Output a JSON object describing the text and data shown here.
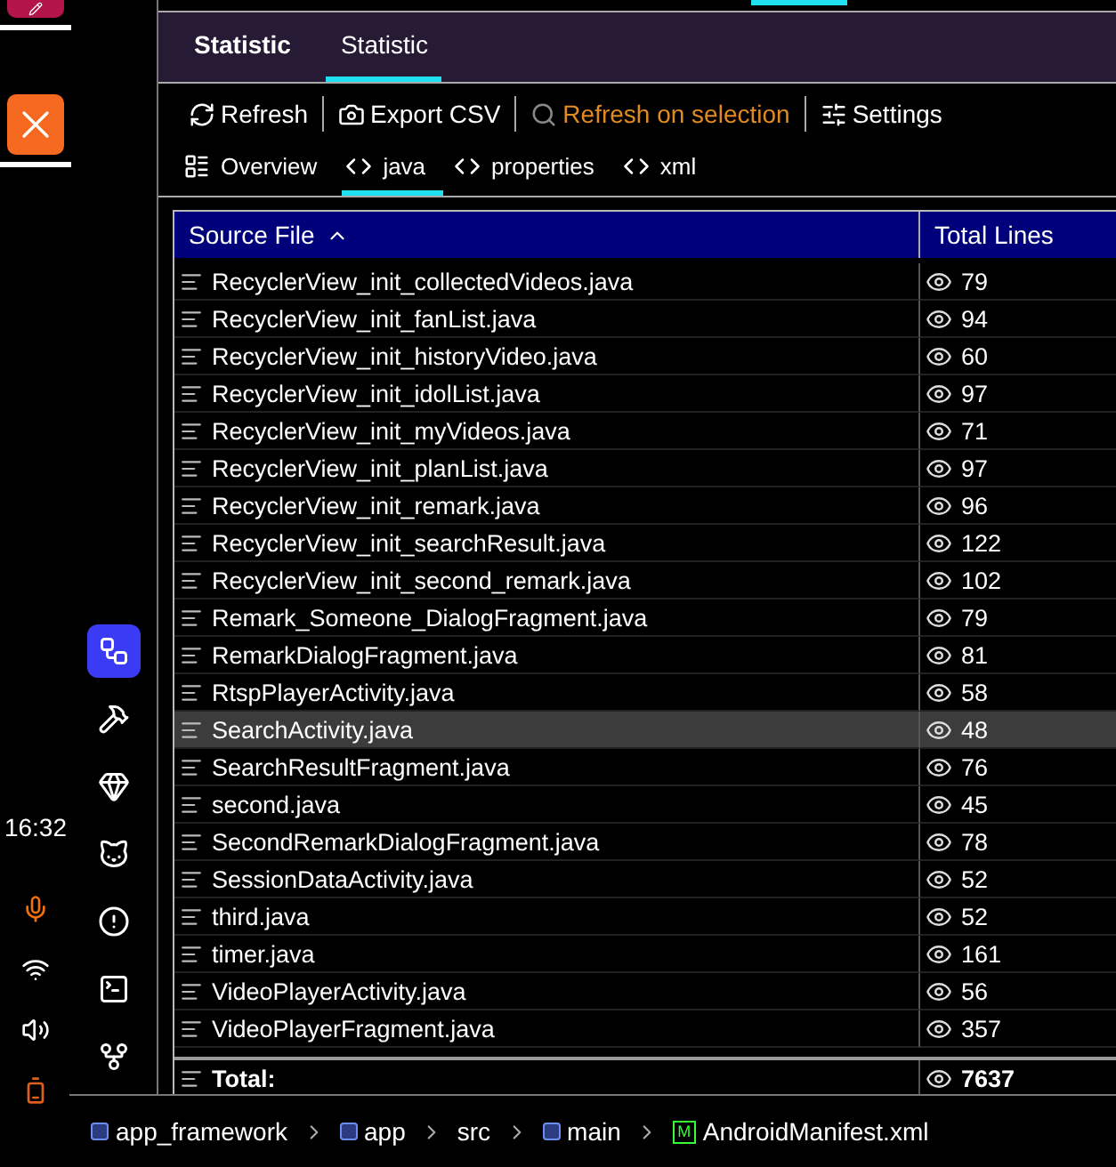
{
  "clock": "16:32",
  "tool_window_tabs": [
    {
      "label": "Statistic",
      "selected": false
    },
    {
      "label": "Statistic",
      "selected": true
    }
  ],
  "toolbar": [
    {
      "kind": "refresh",
      "label": "Refresh",
      "disabled": false
    },
    {
      "kind": "camera",
      "label": "Export CSV",
      "disabled": false
    },
    {
      "kind": "search",
      "label": "Refresh on selection",
      "disabled": true
    },
    {
      "kind": "settings",
      "label": "Settings",
      "disabled": false
    }
  ],
  "sub_tabs": [
    {
      "kind": "overview",
      "label": "Overview",
      "selected": false
    },
    {
      "kind": "filetype",
      "label": "java",
      "selected": true
    },
    {
      "kind": "filetype",
      "label": "properties",
      "selected": false
    },
    {
      "kind": "filetype",
      "label": "xml",
      "selected": false
    }
  ],
  "table": {
    "columns": [
      "Source File",
      "Total Lines"
    ],
    "rows": [
      {
        "file": "RecyclerView_init_collectedVideos.java",
        "lines": "79",
        "selected": false
      },
      {
        "file": "RecyclerView_init_fanList.java",
        "lines": "94",
        "selected": false
      },
      {
        "file": "RecyclerView_init_historyVideo.java",
        "lines": "60",
        "selected": false
      },
      {
        "file": "RecyclerView_init_idolList.java",
        "lines": "97",
        "selected": false
      },
      {
        "file": "RecyclerView_init_myVideos.java",
        "lines": "71",
        "selected": false
      },
      {
        "file": "RecyclerView_init_planList.java",
        "lines": "97",
        "selected": false
      },
      {
        "file": "RecyclerView_init_remark.java",
        "lines": "96",
        "selected": false
      },
      {
        "file": "RecyclerView_init_searchResult.java",
        "lines": "122",
        "selected": false
      },
      {
        "file": "RecyclerView_init_second_remark.java",
        "lines": "102",
        "selected": false
      },
      {
        "file": "Remark_Someone_DialogFragment.java",
        "lines": "79",
        "selected": false
      },
      {
        "file": "RemarkDialogFragment.java",
        "lines": "81",
        "selected": false
      },
      {
        "file": "RtspPlayerActivity.java",
        "lines": "58",
        "selected": false
      },
      {
        "file": "SearchActivity.java",
        "lines": "48",
        "selected": true
      },
      {
        "file": "SearchResultFragment.java",
        "lines": "76",
        "selected": false
      },
      {
        "file": "second.java",
        "lines": "45",
        "selected": false
      },
      {
        "file": "SecondRemarkDialogFragment.java",
        "lines": "78",
        "selected": false
      },
      {
        "file": "SessionDataActivity.java",
        "lines": "52",
        "selected": false
      },
      {
        "file": "third.java",
        "lines": "52",
        "selected": false
      },
      {
        "file": "timer.java",
        "lines": "161",
        "selected": false
      },
      {
        "file": "VideoPlayerActivity.java",
        "lines": "56",
        "selected": false
      },
      {
        "file": "VideoPlayerFragment.java",
        "lines": "357",
        "selected": false
      }
    ],
    "total": {
      "label": "Total:",
      "lines": "7637"
    }
  },
  "breadcrumb": [
    {
      "kind": "module",
      "label": "app_framework"
    },
    {
      "kind": "module",
      "label": "app"
    },
    {
      "kind": "folder",
      "label": "src"
    },
    {
      "kind": "module",
      "label": "main"
    },
    {
      "kind": "manifest",
      "badge": "M",
      "label": "AndroidManifest.xml"
    }
  ]
}
